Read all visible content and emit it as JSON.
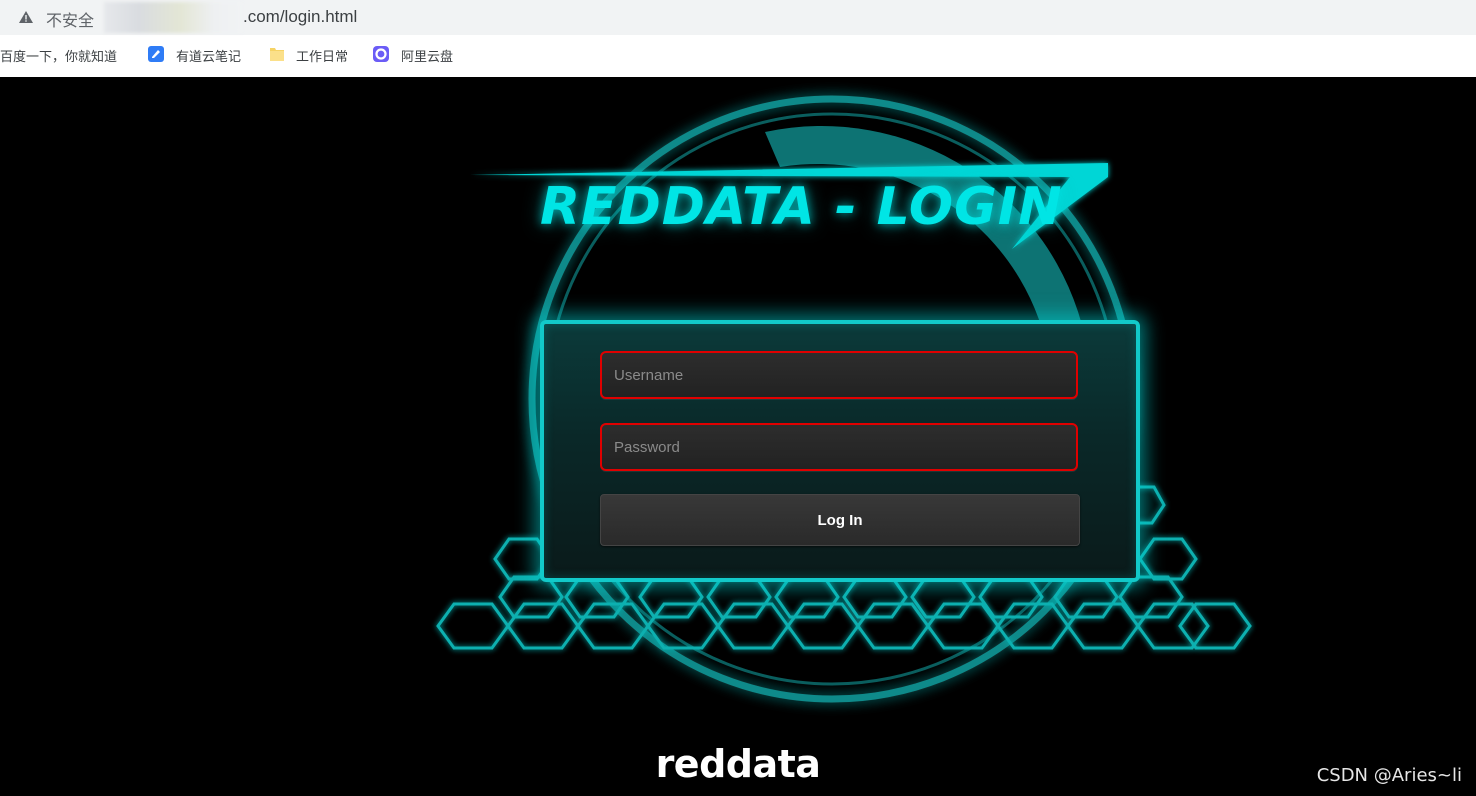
{
  "browser": {
    "security_label": "不安全",
    "url": ".com/login.html",
    "bookmarks": [
      {
        "label": "百度一下，你就知道",
        "icon": "none"
      },
      {
        "label": "有道云笔记",
        "icon": "note-icon"
      },
      {
        "label": "工作日常",
        "icon": "folder-icon"
      },
      {
        "label": "阿里云盘",
        "icon": "cloud-drive-icon"
      }
    ]
  },
  "page": {
    "title": "REDDATA - LOGIN",
    "username_placeholder": "Username",
    "password_placeholder": "Password",
    "login_label": "Log In",
    "footer_title": "reddata",
    "watermark": "CSDN @Aries~li"
  },
  "colors": {
    "accent": "#00e5e5",
    "field_border": "#e00000",
    "background": "#000000"
  }
}
